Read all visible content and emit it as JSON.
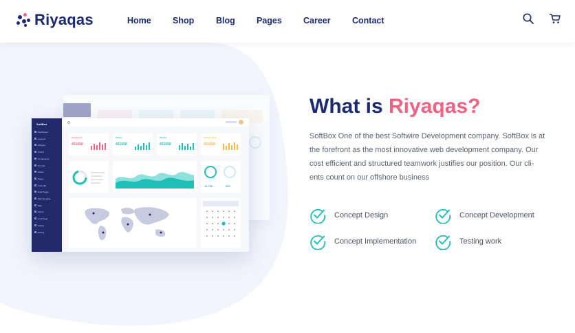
{
  "brand": {
    "name": "Riyaqas"
  },
  "nav": {
    "items": [
      {
        "label": "Home"
      },
      {
        "label": "Shop"
      },
      {
        "label": "Blog"
      },
      {
        "label": "Pages"
      },
      {
        "label": "Career"
      },
      {
        "label": "Contact"
      }
    ]
  },
  "header_icons": {
    "search": "search-icon",
    "cart": "cart-icon"
  },
  "hero": {
    "title_prefix": "What is ",
    "title_accent": "Riyaqas?",
    "description": "SoftBox One of the best Softwire Development company. SoftBox is at the forefront as the most innovative web development company. Our cost efficient and structured teamwork justifies our position. Our cli-ents count on our offshore business",
    "features": [
      {
        "label": "Concept Design"
      },
      {
        "label": "Concept Development"
      },
      {
        "label": "Concept Implementation"
      },
      {
        "label": "Testing work"
      }
    ]
  },
  "mockup": {
    "brand": "SoftBox",
    "menu": [
      "Dashboard",
      "Lessons",
      "Widgets",
      "Charts",
      "UI Elements",
      "Pro Ads",
      "Tables",
      "Pages",
      "Calendar",
      "Data Pages",
      "Mail Template",
      "Map",
      "Forms",
      "Lock Page",
      "Gallery",
      "Setting"
    ],
    "stats": [
      {
        "title": "Customers",
        "value": "451658",
        "color": "#f06282"
      },
      {
        "title": "Orders",
        "value": "451658",
        "color": "#1fbfb8"
      },
      {
        "title": "Earned",
        "value": "451658",
        "color": "#1fbfb8"
      },
      {
        "title": "Visitors Here",
        "value": "451658",
        "color": "#f5b84a"
      }
    ],
    "mini_values": [
      "14 750",
      "550"
    ]
  },
  "colors": {
    "brand_blue": "#1b2a72",
    "accent_pink": "#f06282",
    "teal": "#1fbfb8"
  }
}
